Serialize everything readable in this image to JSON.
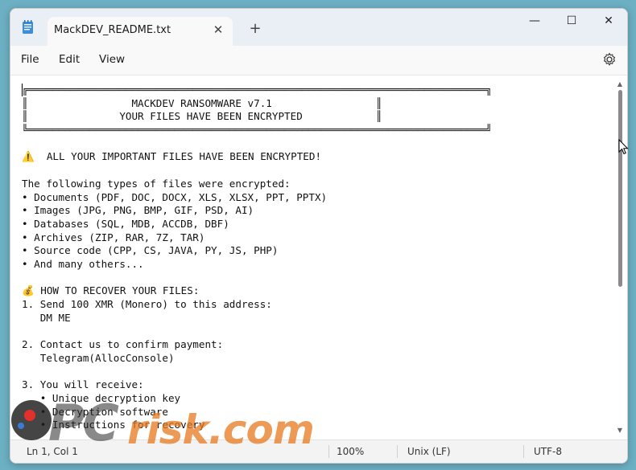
{
  "window": {
    "tab_title": "MackDEV_README.txt",
    "tab_close": "✕",
    "new_tab": "+",
    "minimize": "—",
    "maximize": "☐",
    "close": "✕"
  },
  "menu": {
    "file": "File",
    "edit": "Edit",
    "view": "View",
    "settings_icon": "gear-icon"
  },
  "document": {
    "lines": [
      "╔═══════════════════════════════════════════════════════════════════════════╗",
      "║                 MACKDEV RANSOMWARE v7.1                 ║",
      "║               YOUR FILES HAVE BEEN ENCRYPTED            ║",
      "╚═══════════════════════════════════════════════════════════════════════════╝",
      "",
      "⚠️  ALL YOUR IMPORTANT FILES HAVE BEEN ENCRYPTED!",
      "",
      "The following types of files were encrypted:",
      "• Documents (PDF, DOC, DOCX, XLS, XLSX, PPT, PPTX)",
      "• Images (JPG, PNG, BMP, GIF, PSD, AI)",
      "• Databases (SQL, MDB, ACCDB, DBF)",
      "• Archives (ZIP, RAR, 7Z, TAR)",
      "• Source code (CPP, CS, JAVA, PY, JS, PHP)",
      "• And many others...",
      "",
      "💰 HOW TO RECOVER YOUR FILES:",
      "1. Send 100 XMR (Monero) to this address:",
      "   DM ME",
      "",
      "2. Contact us to confirm payment:",
      "   Telegram(AllocConsole)",
      "",
      "3. You will receive:",
      "   • Unique decryption key",
      "   • Decryption software",
      "   • Instructions for recovery"
    ]
  },
  "status": {
    "position": "Ln 1, Col 1",
    "zoom": "100%",
    "line_endings": "Unix (LF)",
    "encoding": "UTF-8"
  },
  "watermark": {
    "pc": "PC",
    "risk": "risk.com"
  }
}
